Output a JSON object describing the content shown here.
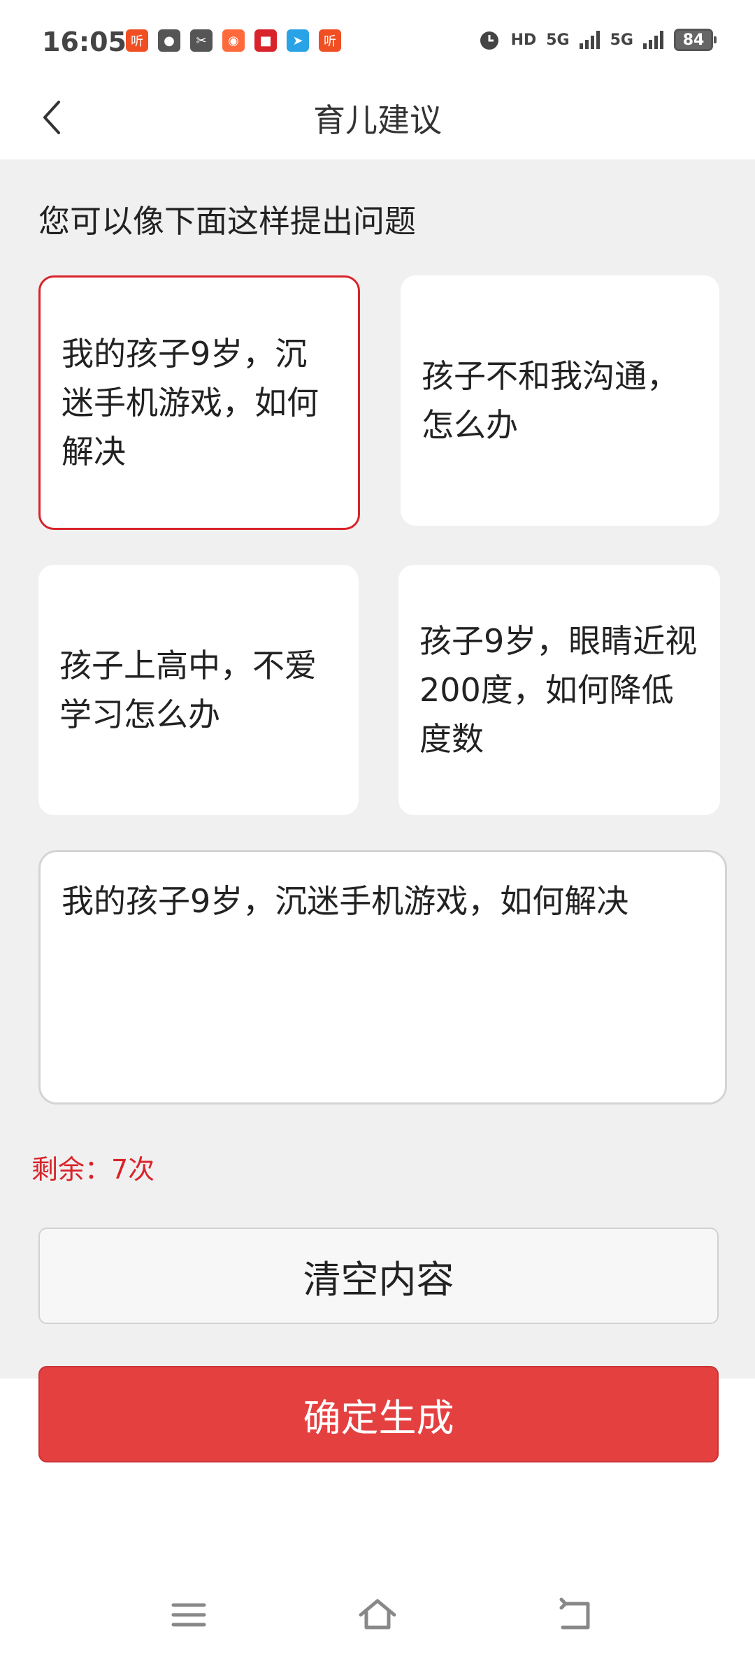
{
  "status_bar": {
    "time": "16:05",
    "notification_icons": [
      {
        "name": "ting-app-icon",
        "glyph": "听",
        "color": "#f04e23"
      },
      {
        "name": "globe-app-icon",
        "glyph": "●",
        "color": "#555555"
      },
      {
        "name": "tool-app-icon",
        "glyph": "✂",
        "color": "#555555"
      },
      {
        "name": "kuaishou-app-icon",
        "glyph": "◉",
        "color": "#ff6a3d"
      },
      {
        "name": "news-app-icon",
        "glyph": "■",
        "color": "#d9232a"
      },
      {
        "name": "send-app-icon",
        "glyph": "➤",
        "color": "#29a3e6"
      },
      {
        "name": "ting-app-icon-2",
        "glyph": "听",
        "color": "#f04e23"
      }
    ],
    "signal_labels": [
      "HD",
      "5G",
      "5G"
    ],
    "battery": "84"
  },
  "navbar": {
    "title": "育儿建议"
  },
  "hint": "您可以像下面这样提出问题",
  "suggestions": [
    "我的孩子9岁，沉迷手机游戏，如何解决",
    "孩子不和我沟通，怎么办",
    "孩子上高中，不爱学习怎么办",
    "孩子9岁，眼睛近视200度，如何降低度数"
  ],
  "question_input": {
    "value": "我的孩子9岁，沉迷手机游戏，如何解决"
  },
  "remaining": "剩余：7次",
  "buttons": {
    "clear": "清空内容",
    "confirm": "确定生成"
  },
  "colors": {
    "accent": "#d9232a",
    "confirm_bg": "#e54040",
    "page_bg": "#f0f0f0"
  }
}
